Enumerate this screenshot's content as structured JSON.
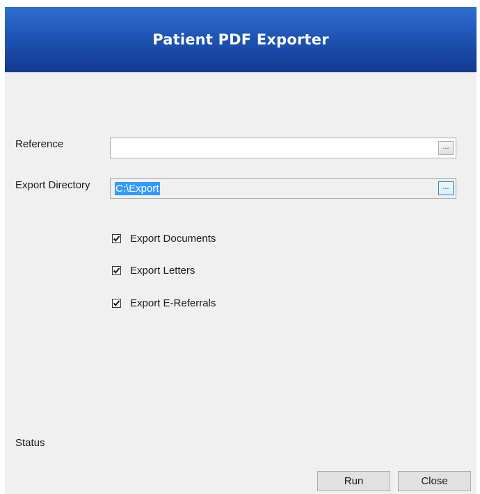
{
  "header": {
    "title": "Patient PDF Exporter"
  },
  "form": {
    "reference": {
      "label": "Reference",
      "value": "",
      "browse_label": "..."
    },
    "export_directory": {
      "label": "Export Directory",
      "value": "C:\\Export",
      "browse_label": "..."
    },
    "options": [
      {
        "label": "Export Documents",
        "checked": true
      },
      {
        "label": "Export Letters",
        "checked": true
      },
      {
        "label": "Export E-Referrals",
        "checked": true
      }
    ]
  },
  "status": {
    "label": "Status"
  },
  "buttons": {
    "run": "Run",
    "close": "Close"
  }
}
